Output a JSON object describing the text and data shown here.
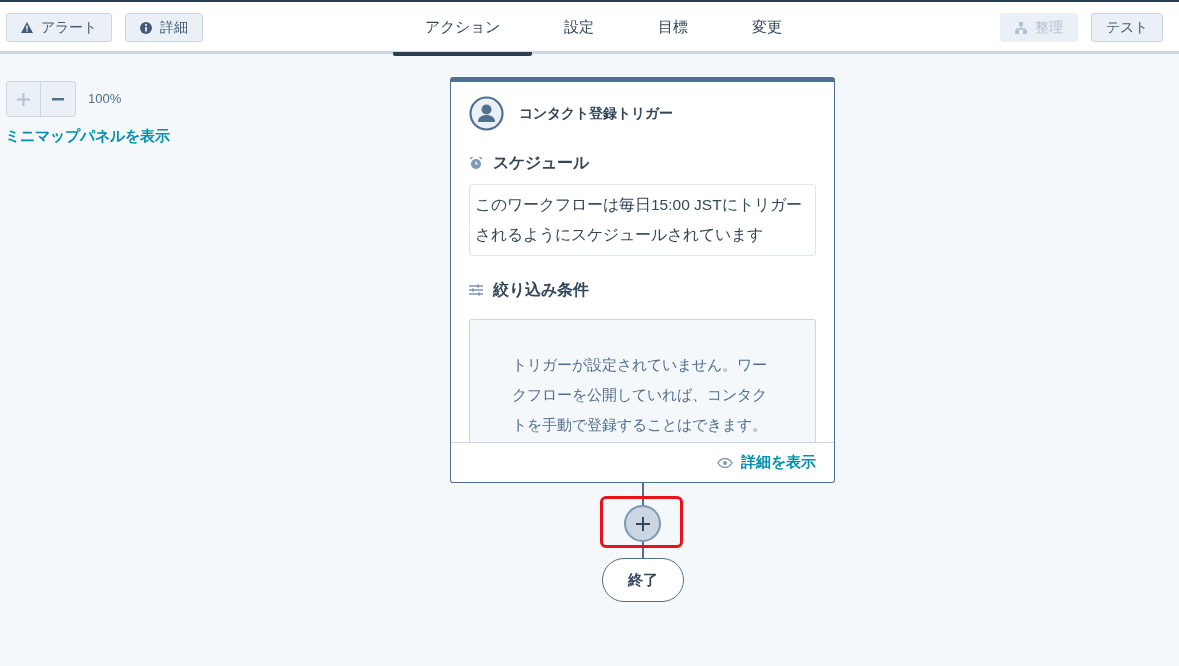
{
  "toolbar_left": [
    {
      "kind": "alert",
      "label": "アラート"
    },
    {
      "kind": "info",
      "label": "詳細"
    }
  ],
  "tabs": [
    {
      "label": "アクション",
      "selected": true
    },
    {
      "label": "設定",
      "selected": false
    },
    {
      "label": "目標",
      "selected": false
    },
    {
      "label": "変更",
      "selected": false
    }
  ],
  "toolbar_right": [
    {
      "kind": "organize",
      "label": "整理",
      "disabled": true
    },
    {
      "kind": "plain",
      "label": "テスト",
      "disabled": false
    }
  ],
  "zoom": {
    "plus_disabled": true,
    "reading": "100%"
  },
  "minimap_link": "ミニマップパネルを表示",
  "trigger_card": {
    "title": "コンタクト登録トリガー",
    "sections": [
      {
        "kind": "schedule",
        "heading": "スケジュール",
        "text": "このワークフローは毎日15:00 JSTにトリガーされるようにスケジュールされています"
      },
      {
        "kind": "filter",
        "heading": "絞り込み条件",
        "text": "トリガーが設定されていません。ワークフローを公開していれば、コンタクトを手動で登録することはできます。"
      }
    ],
    "footer_link": "詳細を表示"
  },
  "end_node": "終了"
}
